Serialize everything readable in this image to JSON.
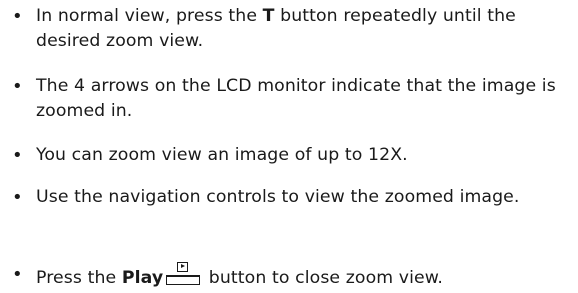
{
  "instructions": [
    {
      "before": "In normal view, press the ",
      "key": "T",
      "after": " button repeatedly until the desired zoom view."
    },
    {
      "text": "The 4 arrows on the LCD monitor indicate that the image is zoomed in."
    },
    {
      "text": "You can zoom view an image of up to 12X."
    },
    {
      "text": "Use the navigation controls to view the zoomed image."
    },
    {
      "before": "Press the ",
      "key": "Play",
      "icon": "play-button-icon",
      "after": " button to close zoom view."
    }
  ],
  "bullet_glyph": "•"
}
